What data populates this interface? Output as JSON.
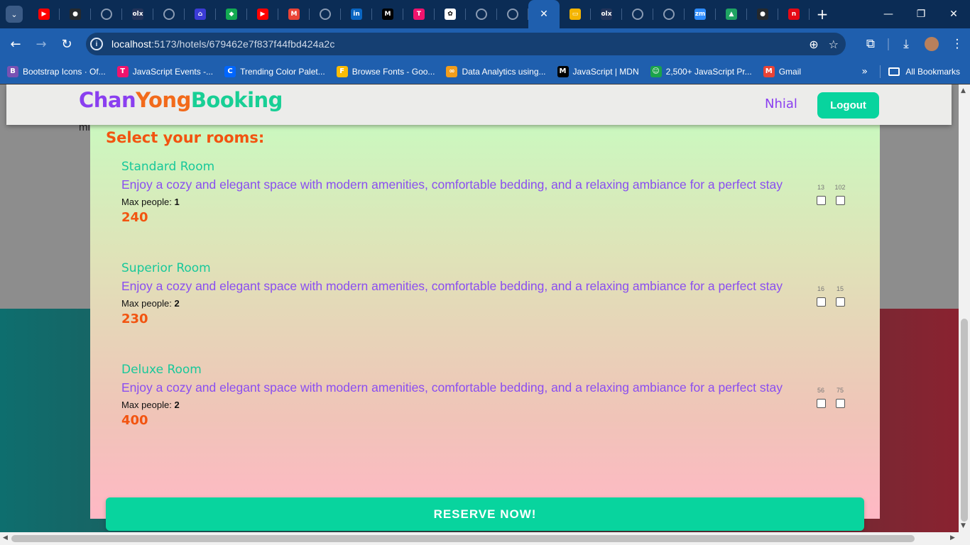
{
  "browser": {
    "tabs": [
      {
        "icon": "youtube-icon",
        "color": "#ff0000",
        "glyph": "▶"
      },
      {
        "icon": "github-icon",
        "color": "#24292e",
        "glyph": "●"
      },
      {
        "icon": "globe-icon",
        "color": "",
        "glyph": ""
      },
      {
        "icon": "olx-icon",
        "color": "#23345a",
        "glyph": "olx"
      },
      {
        "icon": "globe-icon",
        "color": "",
        "glyph": ""
      },
      {
        "icon": "booking-icon",
        "color": "#3b3bd6",
        "glyph": "⌂"
      },
      {
        "icon": "mongodb-icon",
        "color": "#13aa52",
        "glyph": "◆"
      },
      {
        "icon": "youtube-icon",
        "color": "#ff0000",
        "glyph": "▶"
      },
      {
        "icon": "gmail-icon",
        "color": "#ea4335",
        "glyph": "M"
      },
      {
        "icon": "globe-icon",
        "color": "",
        "glyph": ""
      },
      {
        "icon": "linkedin-icon",
        "color": "#0a66c2",
        "glyph": "in"
      },
      {
        "icon": "medium-icon",
        "color": "#000000",
        "glyph": "M"
      },
      {
        "icon": "tpoint-icon",
        "color": "#f0136d",
        "glyph": "T"
      },
      {
        "icon": "chatgpt-icon",
        "color": "#ffffff",
        "glyph": "✿"
      },
      {
        "icon": "globe-icon",
        "color": "",
        "glyph": ""
      },
      {
        "icon": "globe-icon",
        "color": "",
        "glyph": ""
      },
      {
        "icon": "close-icon",
        "color": "",
        "glyph": "✕",
        "active": true
      },
      {
        "icon": "slides-icon",
        "color": "#f4b400",
        "glyph": "▭"
      },
      {
        "icon": "olx-icon",
        "color": "#23345a",
        "glyph": "olx"
      },
      {
        "icon": "globe-icon",
        "color": "",
        "glyph": ""
      },
      {
        "icon": "globe-icon",
        "color": "",
        "glyph": ""
      },
      {
        "icon": "zoom-icon",
        "color": "#2d8cff",
        "glyph": "zm"
      },
      {
        "icon": "drive-icon",
        "color": "#1fa463",
        "glyph": "▲"
      },
      {
        "icon": "github-icon",
        "color": "#24292e",
        "glyph": "●"
      },
      {
        "icon": "netflix-icon",
        "color": "#e50914",
        "glyph": "n"
      }
    ],
    "url_host": "localhost",
    "url_path": ":5173/hotels/679462e7f837f44fbd424a2c",
    "bookmarks": [
      {
        "label": "Bootstrap Icons · Of...",
        "icon": "bootstrap-icon",
        "color": "#7952b3",
        "glyph": "B"
      },
      {
        "label": "JavaScript Events -...",
        "icon": "tpoint-icon",
        "color": "#f0136d",
        "glyph": "T"
      },
      {
        "label": "Trending Color Palet...",
        "icon": "coolors-icon",
        "color": "#0066ff",
        "glyph": "C"
      },
      {
        "label": "Browse Fonts - Goo...",
        "icon": "google-fonts-icon",
        "color": "#fbbc04",
        "glyph": "F"
      },
      {
        "label": "Data Analytics using...",
        "icon": "infinity-icon",
        "color": "#f29d1b",
        "glyph": "∞"
      },
      {
        "label": "JavaScript | MDN",
        "icon": "mdn-icon",
        "color": "#000000",
        "glyph": "M"
      },
      {
        "label": "2,500+ JavaScript Pr...",
        "icon": "project-icon",
        "color": "#1aa34a",
        "glyph": "☺"
      },
      {
        "label": "Gmail",
        "icon": "gmail-icon",
        "color": "#ea4335",
        "glyph": "M"
      }
    ],
    "all_bookmarks": "All Bookmarks"
  },
  "site": {
    "brand": {
      "part1": "Chan",
      "part2": "Yong",
      "part3": "Booking"
    },
    "user": "Nhial",
    "logout_label": "Logout",
    "behind_text": "mi"
  },
  "modal": {
    "title": "Select your rooms:",
    "rooms": [
      {
        "title": "Standard Room",
        "desc": "Enjoy a cozy and elegant space with modern amenities, comfortable bedding, and a relaxing ambiance for a perfect stay",
        "max_label": "Max people: ",
        "max_people": "1",
        "price": "240",
        "numbers": [
          "13",
          "102"
        ]
      },
      {
        "title": "Superior Room",
        "desc": "Enjoy a cozy and elegant space with modern amenities, comfortable bedding, and a relaxing ambiance for a perfect stay",
        "max_label": "Max people: ",
        "max_people": "2",
        "price": "230",
        "numbers": [
          "16",
          "15"
        ]
      },
      {
        "title": "Deluxe Room",
        "desc": "Enjoy a cozy and elegant space with modern amenities, comfortable bedding, and a relaxing ambiance for a perfect stay",
        "max_label": "Max people: ",
        "max_people": "2",
        "price": "400",
        "numbers": [
          "56",
          "75"
        ]
      }
    ],
    "reserve_label": "RESERVE NOW!"
  }
}
